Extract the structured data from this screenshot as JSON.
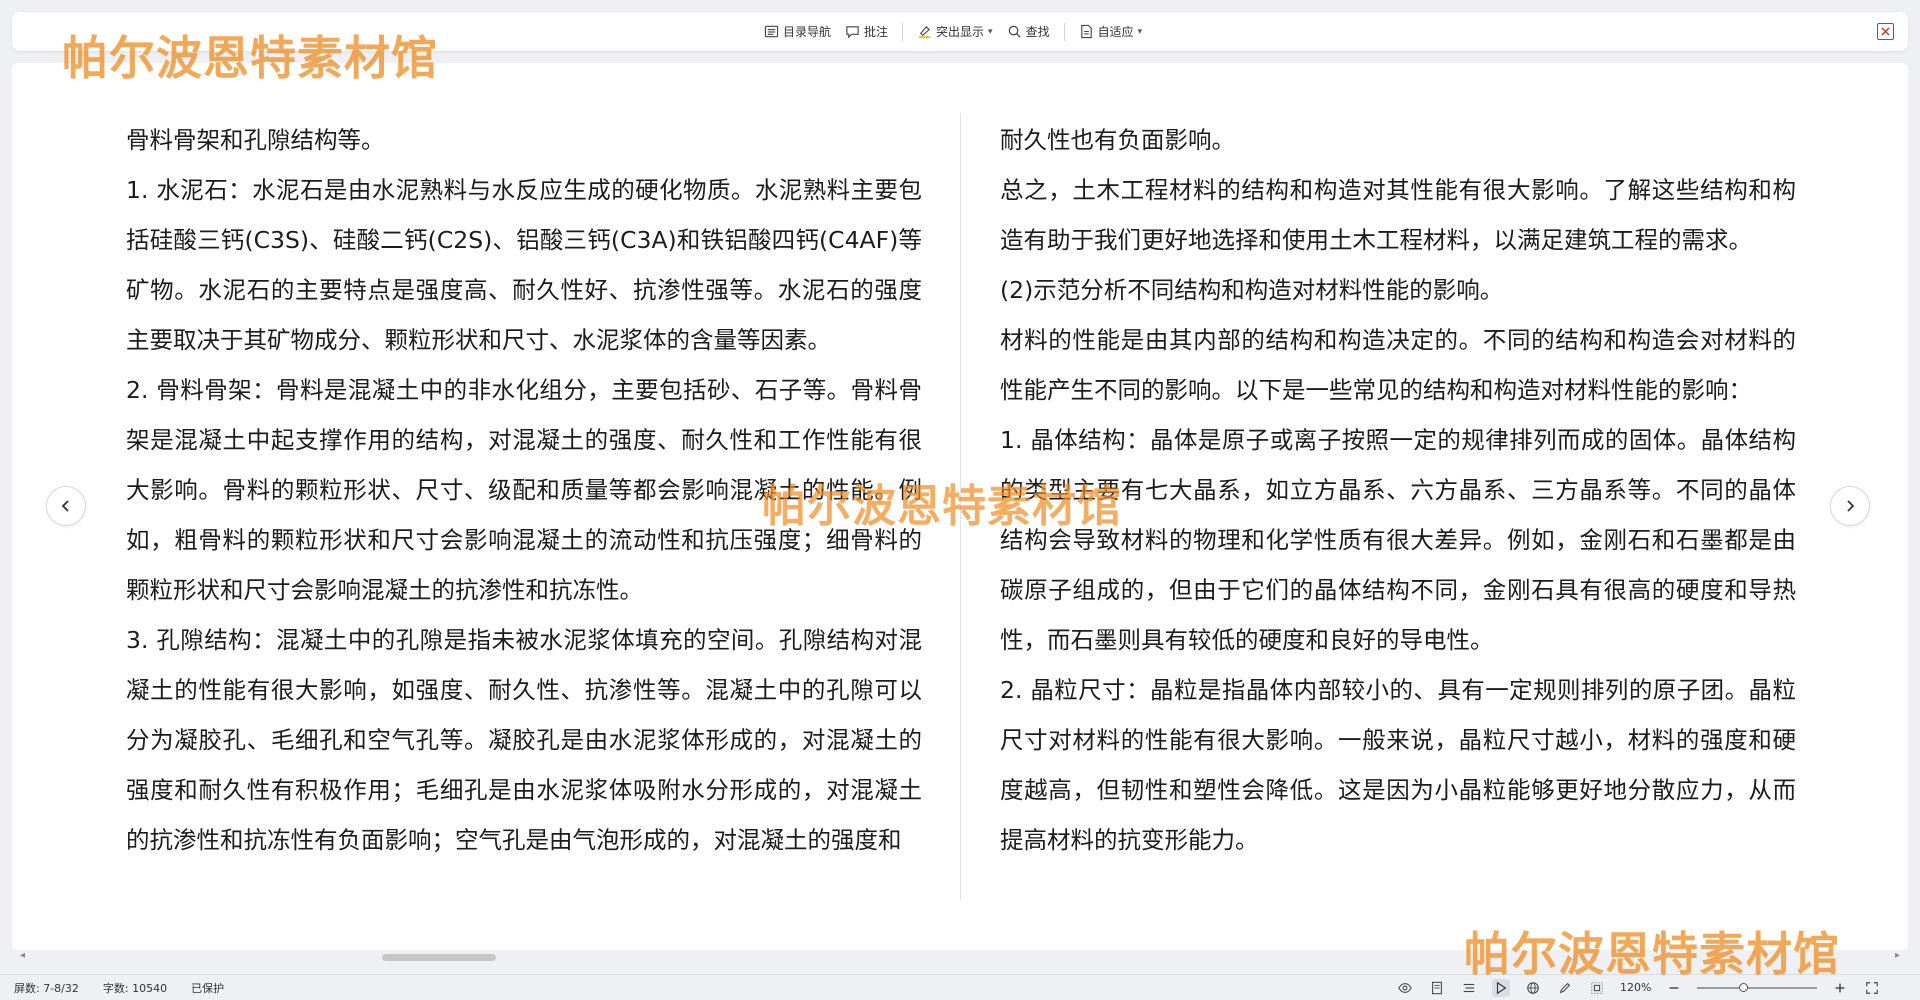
{
  "watermark": "帕尔波恩特素材馆",
  "toolbar": {
    "items": [
      {
        "label": "目录导航",
        "icon": "toc-icon"
      },
      {
        "label": "批注",
        "icon": "comment-icon"
      },
      {
        "label": "突出显示",
        "icon": "highlight-icon"
      },
      {
        "label": "查找",
        "icon": "search-icon"
      },
      {
        "label": "自适应",
        "icon": "fit-page-icon"
      }
    ]
  },
  "document": {
    "left_column": [
      "骨料骨架和孔隙结构等。",
      "1. 水泥石：水泥石是由水泥熟料与水反应生成的硬化物质。水泥熟料主要包括硅酸三钙(C3S)、硅酸二钙(C2S)、铝酸三钙(C3A)和铁铝酸四钙(C4AF)等矿物。水泥石的主要特点是强度高、耐久性好、抗渗性强等。水泥石的强度主要取决于其矿物成分、颗粒形状和尺寸、水泥浆体的含量等因素。",
      "2. 骨料骨架：骨料是混凝土中的非水化组分，主要包括砂、石子等。骨料骨架是混凝土中起支撑作用的结构，对混凝土的强度、耐久性和工作性能有很大影响。骨料的颗粒形状、尺寸、级配和质量等都会影响混凝土的性能。例如，粗骨料的颗粒形状和尺寸会影响混凝土的流动性和抗压强度；细骨料的颗粒形状和尺寸会影响混凝土的抗渗性和抗冻性。",
      "3. 孔隙结构：混凝土中的孔隙是指未被水泥浆体填充的空间。孔隙结构对混凝土的性能有很大影响，如强度、耐久性、抗渗性等。混凝土中的孔隙可以分为凝胶孔、毛细孔和空气孔等。凝胶孔是由水泥浆体形成的，对混凝土的强度和耐久性有积极作用；毛细孔是由水泥浆体吸附水分形成的，对混凝土的抗渗性和抗冻性有负面影响；空气孔是由气泡形成的，对混凝土的强度和"
    ],
    "right_column": [
      "耐久性也有负面影响。",
      "总之，土木工程材料的结构和构造对其性能有很大影响。了解这些结构和构造有助于我们更好地选择和使用土木工程材料，以满足建筑工程的需求。",
      "(2)示范分析不同结构和构造对材料性能的影响。",
      "材料的性能是由其内部的结构和构造决定的。不同的结构和构造会对材料的性能产生不同的影响。以下是一些常见的结构和构造对材料性能的影响：",
      "1. 晶体结构：晶体是原子或离子按照一定的规律排列而成的固体。晶体结构的类型主要有七大晶系，如立方晶系、六方晶系、三方晶系等。不同的晶体结构会导致材料的物理和化学性质有很大差异。例如，金刚石和石墨都是由碳原子组成的，但由于它们的晶体结构不同，金刚石具有很高的硬度和导热性，而石墨则具有较低的硬度和良好的导电性。",
      "2. 晶粒尺寸：晶粒是指晶体内部较小的、具有一定规则排列的原子团。晶粒尺寸对材料的性能有很大影响。一般来说，晶粒尺寸越小，材料的强度和硬度越高，但韧性和塑性会降低。这是因为小晶粒能够更好地分散应力，从而提高材料的抗变形能力。"
    ]
  },
  "statusbar": {
    "screen": "屏数: 7-8/32",
    "word_count": "字数: 10540",
    "protection": "已保护",
    "zoom": "120%",
    "zoom_level": 0.38
  },
  "colors": {
    "watermark": "#ee8f28",
    "close": "#c0392b",
    "background": "#eef0f3"
  }
}
